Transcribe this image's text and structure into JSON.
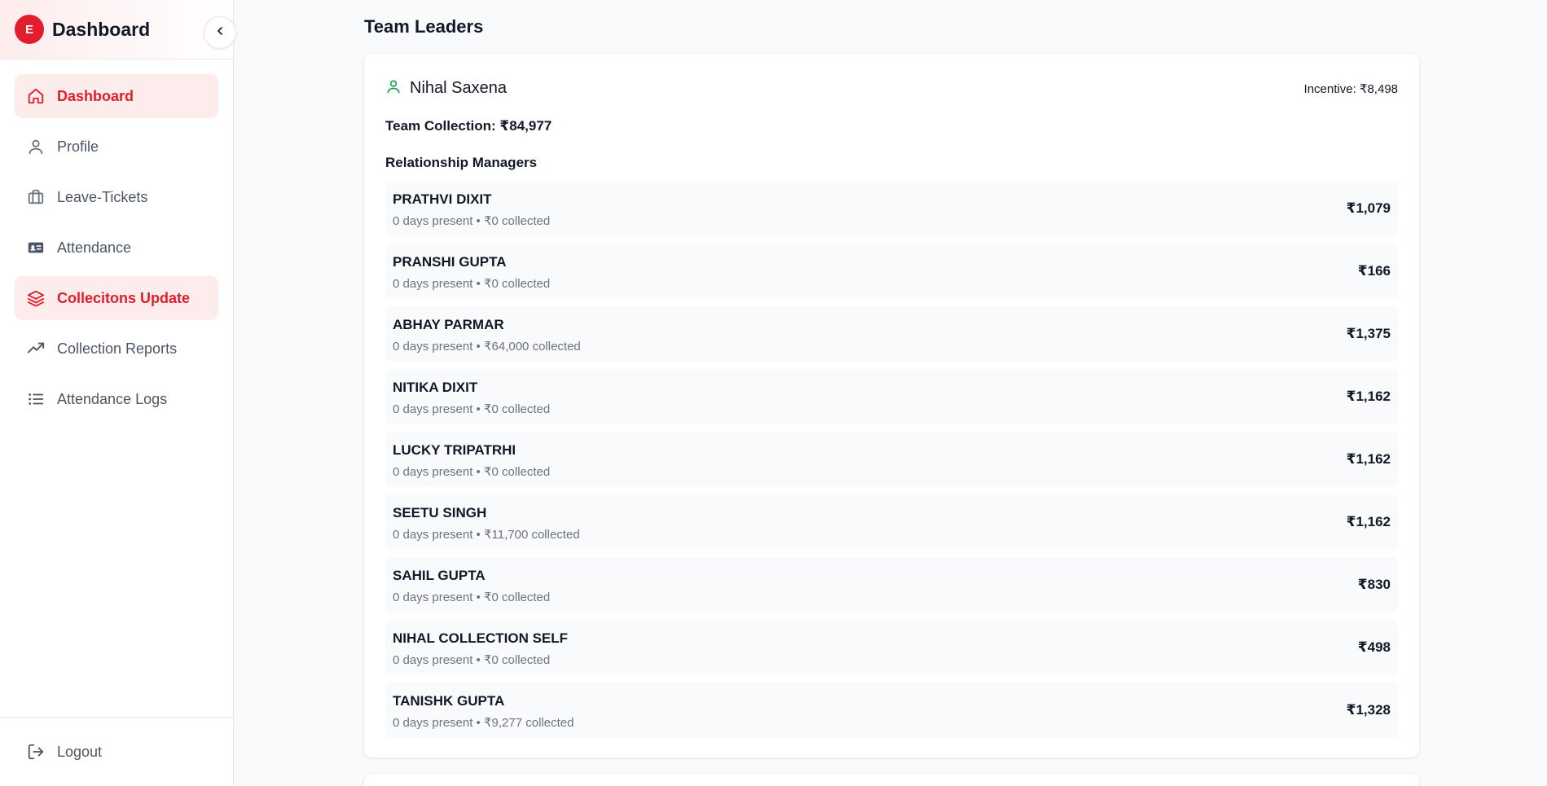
{
  "sidebar": {
    "logo_letter": "E",
    "brand": "Dashboard",
    "items": [
      {
        "label": "Dashboard",
        "icon": "home-icon",
        "active": true
      },
      {
        "label": "Profile",
        "icon": "user-icon",
        "active": false
      },
      {
        "label": "Leave-Tickets",
        "icon": "briefcase-icon",
        "active": false
      },
      {
        "label": "Attendance",
        "icon": "id-card-icon",
        "active": false
      },
      {
        "label": "Collecitons Update",
        "icon": "layers-icon",
        "active": true
      },
      {
        "label": "Collection Reports",
        "icon": "trending-up-icon",
        "active": false
      },
      {
        "label": "Attendance Logs",
        "icon": "list-icon",
        "active": false
      }
    ],
    "logout_label": "Logout"
  },
  "main": {
    "section_title": "Team Leaders",
    "leader": {
      "name": "Nihal Saxena",
      "incentive": "Incentive: ₹8,498",
      "team_collection": "Team Collection: ₹84,977",
      "rm_heading": "Relationship Managers",
      "managers": [
        {
          "name": "PRATHVI DIXIT",
          "meta": "0 days present • ₹0 collected",
          "amount": "₹1,079"
        },
        {
          "name": "PRANSHI GUPTA",
          "meta": "0 days present • ₹0 collected",
          "amount": "₹166"
        },
        {
          "name": "ABHAY PARMAR",
          "meta": "0 days present • ₹64,000 collected",
          "amount": "₹1,375"
        },
        {
          "name": "NITIKA DIXIT",
          "meta": "0 days present • ₹0 collected",
          "amount": "₹1,162"
        },
        {
          "name": "LUCKY TRIPATRHI",
          "meta": "0 days present • ₹0 collected",
          "amount": "₹1,162"
        },
        {
          "name": "SEETU SINGH",
          "meta": "0 days present • ₹11,700 collected",
          "amount": "₹1,162"
        },
        {
          "name": "SAHIL GUPTA",
          "meta": "0 days present • ₹0 collected",
          "amount": "₹830"
        },
        {
          "name": "NIHAL COLLECTION SELF",
          "meta": "0 days present • ₹0 collected",
          "amount": "₹498"
        },
        {
          "name": "TANISHK GUPTA",
          "meta": "0 days present • ₹9,277 collected",
          "amount": "₹1,328"
        }
      ]
    }
  },
  "colors": {
    "accent": "#e11d2e",
    "active_bg": "#fdecec",
    "leader_icon": "#16a34a"
  }
}
